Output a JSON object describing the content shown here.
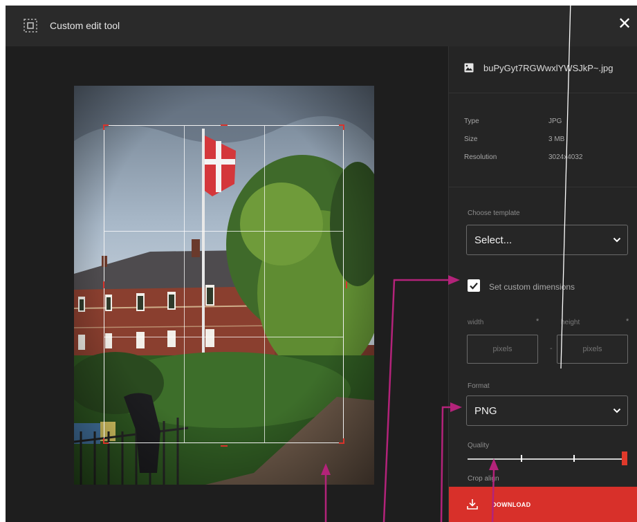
{
  "window": {
    "title": "Custom edit tool",
    "close_glyph": "✕"
  },
  "file": {
    "name": "buPyGyt7RGWwxlYWSJkP~.jpg",
    "icon": "image-file-icon"
  },
  "meta": [
    {
      "key": "Type",
      "value": "JPG"
    },
    {
      "key": "Size",
      "value": "3 MB"
    },
    {
      "key": "Resolution",
      "value": "3024x4032"
    }
  ],
  "template": {
    "label": "Choose template",
    "value": "Select..."
  },
  "custom_dimensions": {
    "label": "Set custom dimensions",
    "checked": true
  },
  "dimensions": {
    "width_label": "width",
    "height_label": "height",
    "required_mark": "*",
    "width_placeholder": "pixels",
    "height_placeholder": "pixels",
    "separator": "-"
  },
  "format": {
    "label": "Format",
    "value": "PNG"
  },
  "quality": {
    "label": "Quality",
    "level": 1.0
  },
  "crop_align": {
    "label": "Crop align"
  },
  "download": {
    "label": "DOWNLOAD"
  },
  "colors": {
    "accent": "#d8302a",
    "annotation": "#b3237a",
    "annotation_line": "#ffffff"
  }
}
